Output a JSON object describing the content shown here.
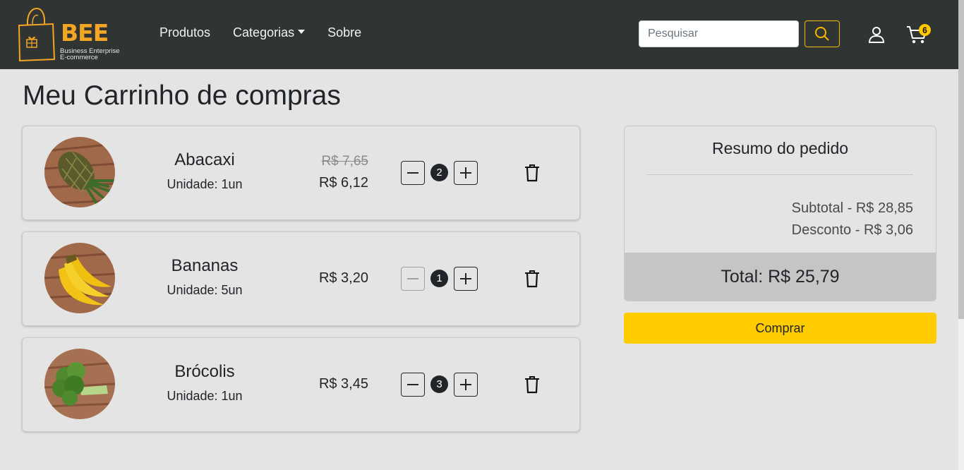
{
  "brand": {
    "name": "BEE",
    "tagline_line1": "Business Enterprise",
    "tagline_line2": "E-commerce",
    "accent_color": "#f5a524"
  },
  "nav": {
    "links": [
      "Produtos",
      "Categorias",
      "Sobre"
    ],
    "search_placeholder": "Pesquisar",
    "cart_count": "6"
  },
  "page": {
    "title": "Meu Carrinho de compras"
  },
  "cart": {
    "items": [
      {
        "name": "Abacaxi",
        "unit": "Unidade: 1un",
        "price_old": "R$ 7,65",
        "price": "R$ 6,12",
        "quantity": "2",
        "minus_disabled": false,
        "image": "pineapple"
      },
      {
        "name": "Bananas",
        "unit": "Unidade: 5un",
        "price_old": "",
        "price": "R$ 3,20",
        "quantity": "1",
        "minus_disabled": true,
        "image": "bananas"
      },
      {
        "name": "Brócolis",
        "unit": "Unidade: 1un",
        "price_old": "",
        "price": "R$ 3,45",
        "quantity": "3",
        "minus_disabled": false,
        "image": "broccoli"
      }
    ]
  },
  "summary": {
    "title": "Resumo do pedido",
    "subtotal": "Subtotal - R$ 28,85",
    "discount": "Desconto - R$ 3,06",
    "total": "Total: R$ 25,79",
    "buy_label": "Comprar",
    "buy_color": "#ffcc00"
  }
}
